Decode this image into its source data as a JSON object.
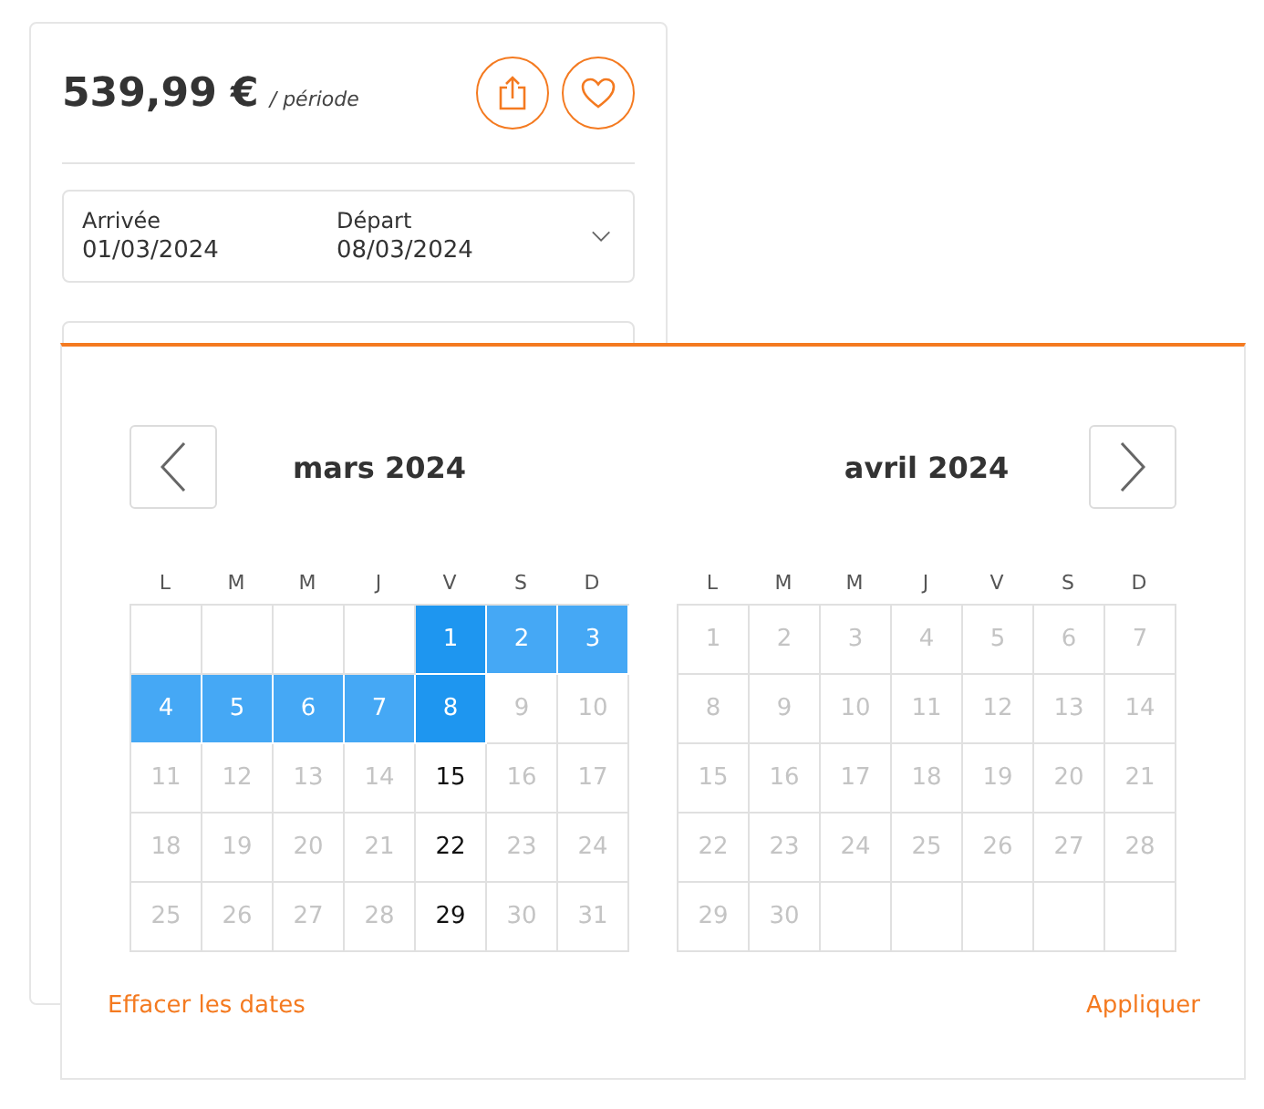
{
  "listing": {
    "price": "539,99 €",
    "period": "/ période",
    "dates": [
      {
        "label": "Arrivée",
        "value": "01/03/2024"
      },
      {
        "label": "Départ",
        "value": "08/03/2024"
      }
    ]
  },
  "calendar": {
    "months": [
      {
        "title": "mars 2024",
        "kind": "prev",
        "weekdays": [
          "L",
          "M",
          "M",
          "J",
          "V",
          "S",
          "D"
        ],
        "days": [
          {
            "kind": "blank"
          },
          {
            "kind": "blank"
          },
          {
            "kind": "blank"
          },
          {
            "kind": "blank"
          },
          {
            "label": "1",
            "kind": "endpoint"
          },
          {
            "label": "2",
            "kind": "range"
          },
          {
            "label": "3",
            "kind": "range"
          },
          {
            "label": "4",
            "kind": "range"
          },
          {
            "label": "5",
            "kind": "range"
          },
          {
            "label": "6",
            "kind": "range"
          },
          {
            "label": "7",
            "kind": "range"
          },
          {
            "label": "8",
            "kind": "endpoint"
          },
          {
            "label": "9",
            "kind": "disabled"
          },
          {
            "label": "10",
            "kind": "disabled"
          },
          {
            "label": "11",
            "kind": "disabled"
          },
          {
            "label": "12",
            "kind": "disabled"
          },
          {
            "label": "13",
            "kind": "disabled"
          },
          {
            "label": "14",
            "kind": "disabled"
          },
          {
            "label": "15",
            "kind": "available"
          },
          {
            "label": "16",
            "kind": "disabled"
          },
          {
            "label": "17",
            "kind": "disabled"
          },
          {
            "label": "18",
            "kind": "disabled"
          },
          {
            "label": "19",
            "kind": "disabled"
          },
          {
            "label": "20",
            "kind": "disabled"
          },
          {
            "label": "21",
            "kind": "disabled"
          },
          {
            "label": "22",
            "kind": "available"
          },
          {
            "label": "23",
            "kind": "disabled"
          },
          {
            "label": "24",
            "kind": "disabled"
          },
          {
            "label": "25",
            "kind": "disabled"
          },
          {
            "label": "26",
            "kind": "disabled"
          },
          {
            "label": "27",
            "kind": "disabled"
          },
          {
            "label": "28",
            "kind": "disabled"
          },
          {
            "label": "29",
            "kind": "available"
          },
          {
            "label": "30",
            "kind": "disabled"
          },
          {
            "label": "31",
            "kind": "disabled"
          }
        ]
      },
      {
        "title": "avril 2024",
        "kind": "next",
        "weekdays": [
          "L",
          "M",
          "M",
          "J",
          "V",
          "S",
          "D"
        ],
        "days": [
          {
            "label": "1",
            "kind": "disabled"
          },
          {
            "label": "2",
            "kind": "disabled"
          },
          {
            "label": "3",
            "kind": "disabled"
          },
          {
            "label": "4",
            "kind": "disabled"
          },
          {
            "label": "5",
            "kind": "disabled"
          },
          {
            "label": "6",
            "kind": "disabled"
          },
          {
            "label": "7",
            "kind": "disabled"
          },
          {
            "label": "8",
            "kind": "disabled"
          },
          {
            "label": "9",
            "kind": "disabled"
          },
          {
            "label": "10",
            "kind": "disabled"
          },
          {
            "label": "11",
            "kind": "disabled"
          },
          {
            "label": "12",
            "kind": "disabled"
          },
          {
            "label": "13",
            "kind": "disabled"
          },
          {
            "label": "14",
            "kind": "disabled"
          },
          {
            "label": "15",
            "kind": "disabled"
          },
          {
            "label": "16",
            "kind": "disabled"
          },
          {
            "label": "17",
            "kind": "disabled"
          },
          {
            "label": "18",
            "kind": "disabled"
          },
          {
            "label": "19",
            "kind": "disabled"
          },
          {
            "label": "20",
            "kind": "disabled"
          },
          {
            "label": "21",
            "kind": "disabled"
          },
          {
            "label": "22",
            "kind": "disabled"
          },
          {
            "label": "23",
            "kind": "disabled"
          },
          {
            "label": "24",
            "kind": "disabled"
          },
          {
            "label": "25",
            "kind": "disabled"
          },
          {
            "label": "26",
            "kind": "disabled"
          },
          {
            "label": "27",
            "kind": "disabled"
          },
          {
            "label": "28",
            "kind": "disabled"
          },
          {
            "label": "29",
            "kind": "disabled"
          },
          {
            "label": "30",
            "kind": "disabled"
          },
          {
            "kind": "blank"
          },
          {
            "kind": "blank"
          },
          {
            "kind": "blank"
          },
          {
            "kind": "blank"
          },
          {
            "kind": "blank"
          }
        ]
      }
    ],
    "clear": "Effacer les dates",
    "apply": "Appliquer"
  }
}
